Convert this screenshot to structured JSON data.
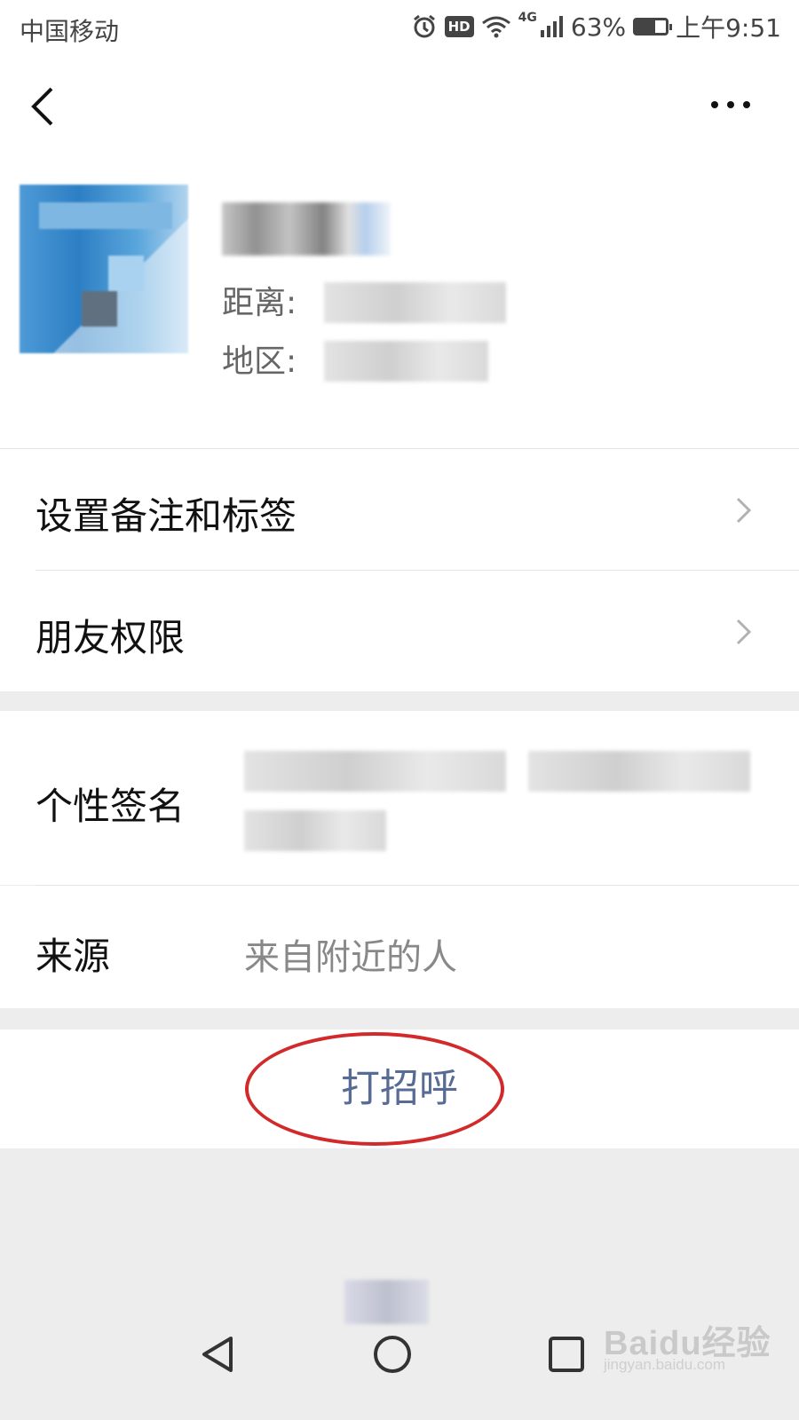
{
  "status_bar": {
    "carrier": "中国移动",
    "hd": "HD",
    "network": "4G",
    "battery": "63%",
    "battery_level": 0.63,
    "time": "上午9:51"
  },
  "nav": {
    "back_icon": "chevron-left-icon",
    "more_icon": "more-horizontal-icon"
  },
  "profile": {
    "distance_label": "距离:",
    "region_label": "地区:"
  },
  "menu": [
    {
      "label": "设置备注和标签",
      "icon": "chevron-right-icon"
    },
    {
      "label": "朋友权限",
      "icon": "chevron-right-icon"
    }
  ],
  "details": {
    "signature_label": "个性签名",
    "source_label": "来源",
    "source_value": "来自附近的人"
  },
  "greet": {
    "label": "打招呼"
  },
  "annotation": {
    "color": "#d22a2a"
  },
  "watermark": {
    "main": "Baidu经验",
    "sub": "jingyan.baidu.com"
  },
  "colors": {
    "link": "#576b95",
    "background": "#ededed"
  }
}
